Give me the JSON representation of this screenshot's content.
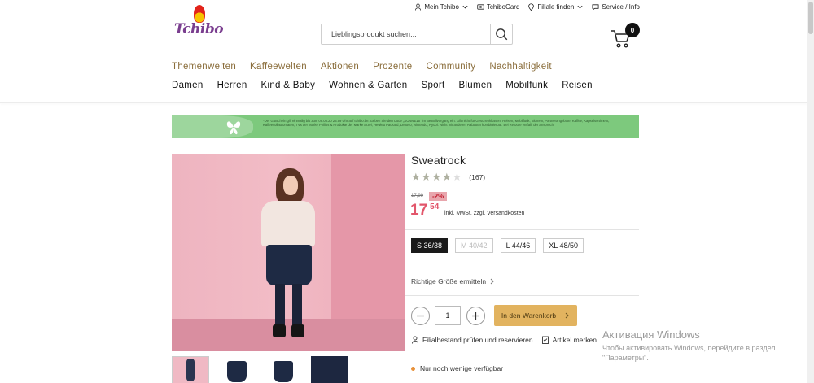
{
  "header": {
    "logo_text": "Tchibo",
    "topnav": [
      {
        "label": "Mein Tchibo",
        "icon": "user-icon",
        "dropdown": true
      },
      {
        "label": "TchiboCard",
        "icon": "card-icon",
        "dropdown": false
      },
      {
        "label": "Filiale finden",
        "icon": "location-icon",
        "dropdown": true
      },
      {
        "label": "Service / Info",
        "icon": "chat-icon",
        "dropdown": false
      }
    ],
    "search_placeholder": "Lieblingsprodukt suchen...",
    "cart_count": "0"
  },
  "mainnav": [
    "Themenwelten",
    "Kaffeewelten",
    "Aktionen",
    "Prozente",
    "Community",
    "Nachhaltigkeit"
  ],
  "catnav": [
    "Damen",
    "Herren",
    "Kind & Baby",
    "Wohnen & Garten",
    "Sport",
    "Blumen",
    "Mobilfunk",
    "Reisen"
  ],
  "banner": {
    "text": "*Der Gutschein gilt einmalig bis zum 09.08.20 23:59 Uhr auf tchibo.de. Geben Sie den Code „SONNE15“ im Bestellvorgang ein. Gilt nicht für Geschenkkarten, Reisen, Mobilfunk, Blumen, Partnerangebote, Kaffee, Kapselsortiment, Kaffeevollautomaten, TVs der Marke Philips & Produkte der Marke Arzei, Hewlett Packard, Lenovo, Nintendo, Ryobi. Nicht mit anderen Rabatten kombinierbar. Bei Retoure entfällt der Anspruch."
  },
  "product": {
    "title": "Sweatrock",
    "rating": 4,
    "rating_max": 5,
    "review_count": "(167)",
    "old_price": "17,99",
    "discount": "-2%",
    "price_euro": "17",
    "price_cent": "54",
    "vat_note": "inkl. MwSt. zzgl. Versandkosten",
    "sizes": [
      {
        "label": "S 36/38",
        "state": "selected"
      },
      {
        "label": "M 40/42",
        "state": "unavailable"
      },
      {
        "label": "L 44/46",
        "state": "available"
      },
      {
        "label": "XL 48/50",
        "state": "available"
      }
    ],
    "size_link": "Richtige Größe ermitteln",
    "quantity": "1",
    "add_to_cart": "In den Warenkorb",
    "store_check": "Filialbestand prüfen und reservieren",
    "bookmark": "Artikel merken",
    "availability": "Nur noch wenige verfügbar"
  },
  "colors": {
    "nav_gold": "#8a6d3b",
    "price_red": "#e2566b",
    "cart_button": "#e2b35f",
    "banner_green": "#7dc97d",
    "availability_dot": "#e8913a"
  },
  "watermark": {
    "title": "Активация Windows",
    "line1": "Чтобы активировать Windows, перейдите в раздел",
    "line2": "\"Параметры\"."
  }
}
